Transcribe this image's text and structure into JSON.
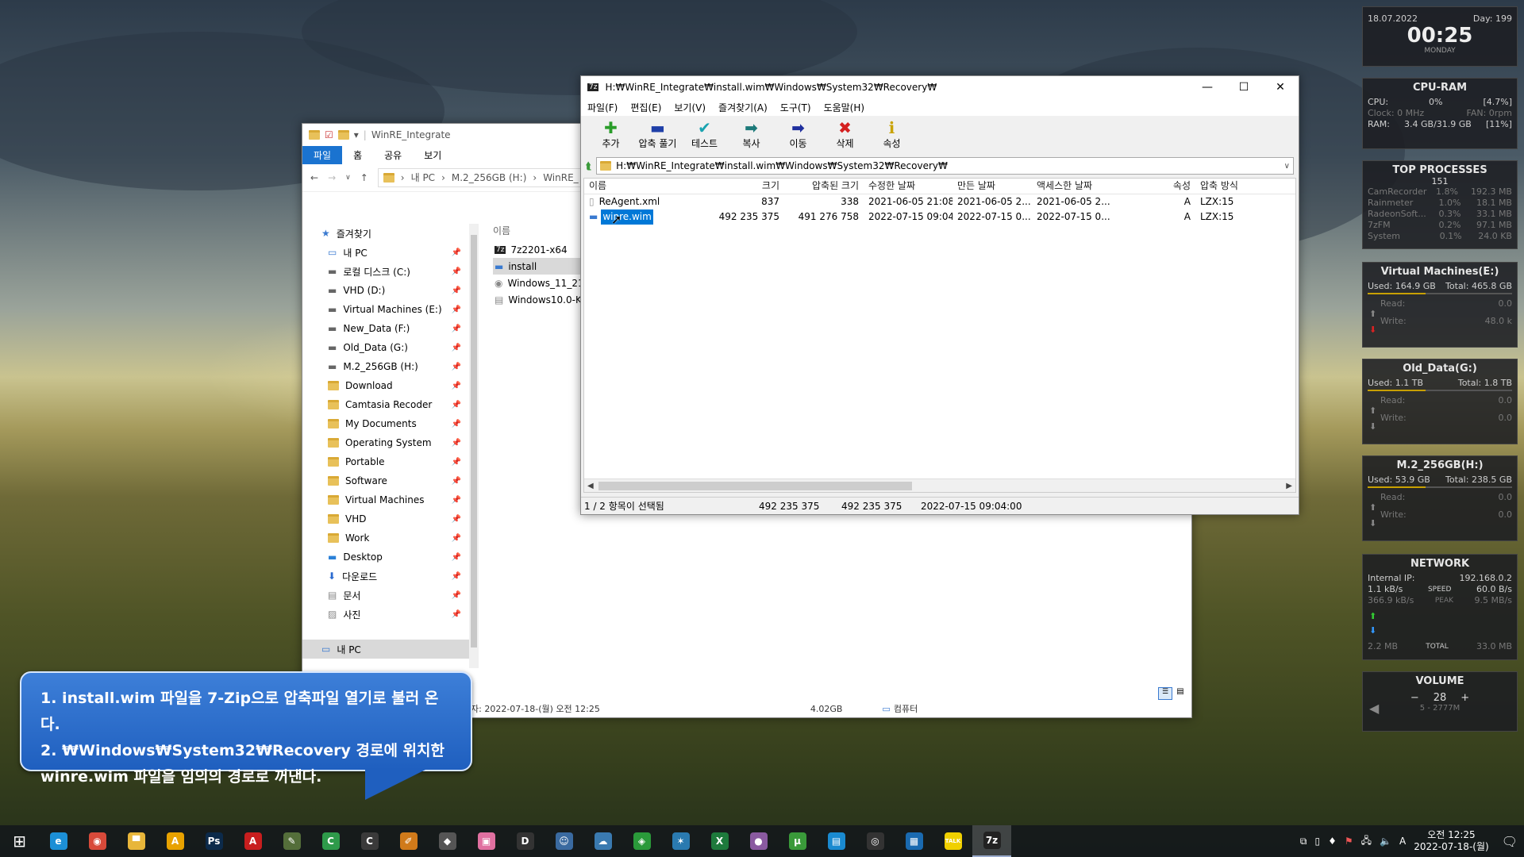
{
  "explorer": {
    "title": "WinRE_Integrate",
    "ribbon": [
      "파일",
      "홈",
      "공유",
      "보기"
    ],
    "breadcrumb": [
      "내 PC",
      "M.2_256GB (H:)",
      "WinRE_"
    ],
    "sidebar": [
      {
        "label": "즐겨찾기",
        "icon": "star-icon",
        "pin": false
      },
      {
        "label": "내 PC",
        "icon": "pc-icon",
        "pin": true
      },
      {
        "label": "로컬 디스크 (C:)",
        "icon": "drive-icon",
        "pin": true
      },
      {
        "label": "VHD (D:)",
        "icon": "drive-icon",
        "pin": true
      },
      {
        "label": "Virtual Machines (E:)",
        "icon": "drive-icon",
        "pin": true
      },
      {
        "label": "New_Data (F:)",
        "icon": "drive-icon",
        "pin": true
      },
      {
        "label": "Old_Data (G:)",
        "icon": "drive-icon",
        "pin": true
      },
      {
        "label": "M.2_256GB (H:)",
        "icon": "drive-icon",
        "pin": true
      },
      {
        "label": "Download",
        "icon": "folder-icon",
        "pin": true
      },
      {
        "label": "Camtasia Recoder",
        "icon": "folder-icon",
        "pin": true
      },
      {
        "label": "My Documents",
        "icon": "folder-icon",
        "pin": true
      },
      {
        "label": "Operating System",
        "icon": "folder-icon",
        "pin": true
      },
      {
        "label": "Portable",
        "icon": "folder-icon",
        "pin": true
      },
      {
        "label": "Software",
        "icon": "folder-icon",
        "pin": true
      },
      {
        "label": "Virtual Machines",
        "icon": "folder-icon",
        "pin": true
      },
      {
        "label": "VHD",
        "icon": "folder-icon",
        "pin": true
      },
      {
        "label": "Work",
        "icon": "folder-icon",
        "pin": true
      },
      {
        "label": "Desktop",
        "icon": "desktop-icon",
        "pin": true
      },
      {
        "label": "다운로드",
        "icon": "download-icon",
        "pin": true
      },
      {
        "label": "문서",
        "icon": "document-icon",
        "pin": true
      },
      {
        "label": "사진",
        "icon": "picture-icon",
        "pin": true
      }
    ],
    "sidebar_bottom": "내 PC",
    "list_header": "이름",
    "files": [
      "7z2201-x64",
      "install",
      "Windows_11_21",
      "Windows10.0-K"
    ],
    "status_date": "자: 2022-07-18-(월) 오전 12:25",
    "status_size": "4.02GB",
    "status_computer": "컴퓨터"
  },
  "zip": {
    "title": "H:₩WinRE_Integrate₩install.wim₩Windows₩System32₩Recovery₩",
    "menu": [
      "파일(F)",
      "편집(E)",
      "보기(V)",
      "즐겨찾기(A)",
      "도구(T)",
      "도움말(H)"
    ],
    "toolbar": [
      {
        "label": "추가",
        "icon": "add-icon",
        "glyph": "✚",
        "color": "#2a9d2a"
      },
      {
        "label": "압축 풀기",
        "icon": "extract-icon",
        "glyph": "▬",
        "color": "#1f3fa8"
      },
      {
        "label": "테스트",
        "icon": "test-icon",
        "glyph": "✔",
        "color": "#19a3b0"
      },
      {
        "label": "복사",
        "icon": "copy-icon",
        "glyph": "➡",
        "color": "#1d7a7a"
      },
      {
        "label": "이동",
        "icon": "move-icon",
        "glyph": "➡",
        "color": "#1f2f9e"
      },
      {
        "label": "삭제",
        "icon": "delete-icon",
        "glyph": "✖",
        "color": "#d42020"
      },
      {
        "label": "속성",
        "icon": "info-icon",
        "glyph": "ℹ",
        "color": "#c9a200"
      }
    ],
    "address": "H:₩WinRE_Integrate₩install.wim₩Windows₩System32₩Recovery₩",
    "columns": [
      "이름",
      "크기",
      "압축된 크기",
      "수정한 날짜",
      "만든 날짜",
      "액세스한 날짜",
      "속성",
      "압축 방식"
    ],
    "rows": [
      [
        "ReAgent.xml",
        "837",
        "338",
        "2021-06-05 21:08",
        "2021-06-05 2...",
        "2021-06-05 2...",
        "A",
        "LZX:15"
      ],
      [
        "winre.wim",
        "492 235 375",
        "491 276 758",
        "2022-07-15 09:04",
        "2022-07-15 0...",
        "2022-07-15 0...",
        "A",
        "LZX:15"
      ]
    ],
    "selected_row": 1,
    "status": [
      "1 / 2 항목이 선택됨",
      "492 235 375",
      "492 235 375",
      "2022-07-15 09:04:00"
    ]
  },
  "callout": {
    "lines": [
      "1. install.wim 파일을 7-Zip으로 압축파일 열기로 불러 온다.",
      "2. ₩Windows₩System32₩Recovery 경로에 위치한",
      "winre.wim 파일을 임의의 경로로 꺼낸다."
    ]
  },
  "widgets": {
    "clock": {
      "date": "18.07.2022",
      "day": "Day: 199",
      "time": "00:25",
      "weekday": "MONDAY"
    },
    "cpuram": {
      "title": "CPU-RAM",
      "cpu_label": "CPU:",
      "cpu_val": "0%",
      "cpu_pct": "[4.7%]",
      "clock": "Clock: 0 MHz",
      "fan": "FAN: 0rpm",
      "ram_label": "RAM:",
      "ram_val": "3.4 GB/31.9 GB",
      "ram_pct": "[11%]"
    },
    "processes": {
      "title": "TOP PROCESSES",
      "count": "151",
      "rows": [
        [
          "CamRecorder",
          "1.8%",
          "192.3 MB"
        ],
        [
          "Rainmeter",
          "1.0%",
          "18.1 MB"
        ],
        [
          "RadeonSoft...",
          "0.3%",
          "33.1 MB"
        ],
        [
          "7zFM",
          "0.2%",
          "97.1 MB"
        ],
        [
          "System",
          "0.1%",
          "24.0 KB"
        ]
      ]
    },
    "drives": [
      {
        "title": "Virtual Machines(E:)",
        "used": "Used: 164.9 GB",
        "total": "Total: 465.8 GB",
        "read": "Read:",
        "write": "Write:",
        "rv": "0.0",
        "wv": "48.0 k"
      },
      {
        "title": "Old_Data(G:)",
        "used": "Used: 1.1 TB",
        "total": "Total: 1.8 TB",
        "read": "Read:",
        "write": "Write:",
        "rv": "0.0",
        "wv": "0.0"
      },
      {
        "title": "M.2_256GB(H:)",
        "used": "Used: 53.9 GB",
        "total": "Total: 238.5 GB",
        "read": "Read:",
        "write": "Write:",
        "rv": "0.0",
        "wv": "0.0"
      }
    ],
    "network": {
      "title": "NETWORK",
      "ip_label": "Internal IP:",
      "ip": "192.168.0.2",
      "up": "1.1 kB/s",
      "speed_label": "SPEED",
      "speed": "60.0 B/s",
      "down": "366.9 kB/s",
      "peak_label": "PEAK",
      "peak": "9.5 MB/s",
      "total_up": "2.2 MB",
      "total_label": "TOTAL",
      "total_down": "33.0 MB"
    },
    "volume": {
      "title": "VOLUME",
      "minus": "−",
      "value": "28",
      "plus": "+",
      "device": "5 - 2777M"
    }
  },
  "taskbar": {
    "apps": [
      {
        "name": "start-icon",
        "glyph": "⊞",
        "bg": ""
      },
      {
        "name": "edge-icon",
        "glyph": "e",
        "bg": "#1c8fd6"
      },
      {
        "name": "chrome-icon",
        "glyph": "◉",
        "bg": "#d84a3a"
      },
      {
        "name": "explorer-icon",
        "glyph": "▀",
        "bg": "#e8b63a"
      },
      {
        "name": "archicad-icon",
        "glyph": "A",
        "bg": "#e8a200"
      },
      {
        "name": "photoshop-icon",
        "glyph": "Ps",
        "bg": "#0c2a4a"
      },
      {
        "name": "acrobat-icon",
        "glyph": "A",
        "bg": "#c81e1e"
      },
      {
        "name": "tool-icon",
        "glyph": "✎",
        "bg": "#546e3a"
      },
      {
        "name": "camtasia-icon",
        "glyph": "C",
        "bg": "#2e9a4a"
      },
      {
        "name": "camtasia2-icon",
        "glyph": "C",
        "bg": "#3a3a3a"
      },
      {
        "name": "pencil-icon",
        "glyph": "✐",
        "bg": "#d07a1a"
      },
      {
        "name": "box-icon",
        "glyph": "◆",
        "bg": "#555"
      },
      {
        "name": "pink-app-icon",
        "glyph": "▣",
        "bg": "#e070a0"
      },
      {
        "name": "d-app-icon",
        "glyph": "D",
        "bg": "#333"
      },
      {
        "name": "people-icon",
        "glyph": "☺",
        "bg": "#3a6aa0"
      },
      {
        "name": "cloud-icon",
        "glyph": "☁",
        "bg": "#3a7ab0"
      },
      {
        "name": "green-app-icon",
        "glyph": "◈",
        "bg": "#2a9a3a"
      },
      {
        "name": "network-app-icon",
        "glyph": "✶",
        "bg": "#2a7ab0"
      },
      {
        "name": "excel-icon",
        "glyph": "X",
        "bg": "#1e7a3c"
      },
      {
        "name": "media-icon",
        "glyph": "●",
        "bg": "#8a5aa0"
      },
      {
        "name": "torrent-icon",
        "glyph": "µ",
        "bg": "#3a9a3a"
      },
      {
        "name": "blue-app-icon",
        "glyph": "▤",
        "bg": "#1a8ad0"
      },
      {
        "name": "obs-icon",
        "glyph": "◎",
        "bg": "#333"
      },
      {
        "name": "vm-icon",
        "glyph": "▦",
        "bg": "#1a6ab0"
      },
      {
        "name": "kakao-icon",
        "glyph": "TALK",
        "bg": "#f0d000"
      },
      {
        "name": "7zip-icon",
        "glyph": "7z",
        "bg": "#222"
      }
    ],
    "active_index": 25,
    "ime": "A",
    "time": "오전 12:25",
    "date": "2022-07-18-(월)"
  }
}
